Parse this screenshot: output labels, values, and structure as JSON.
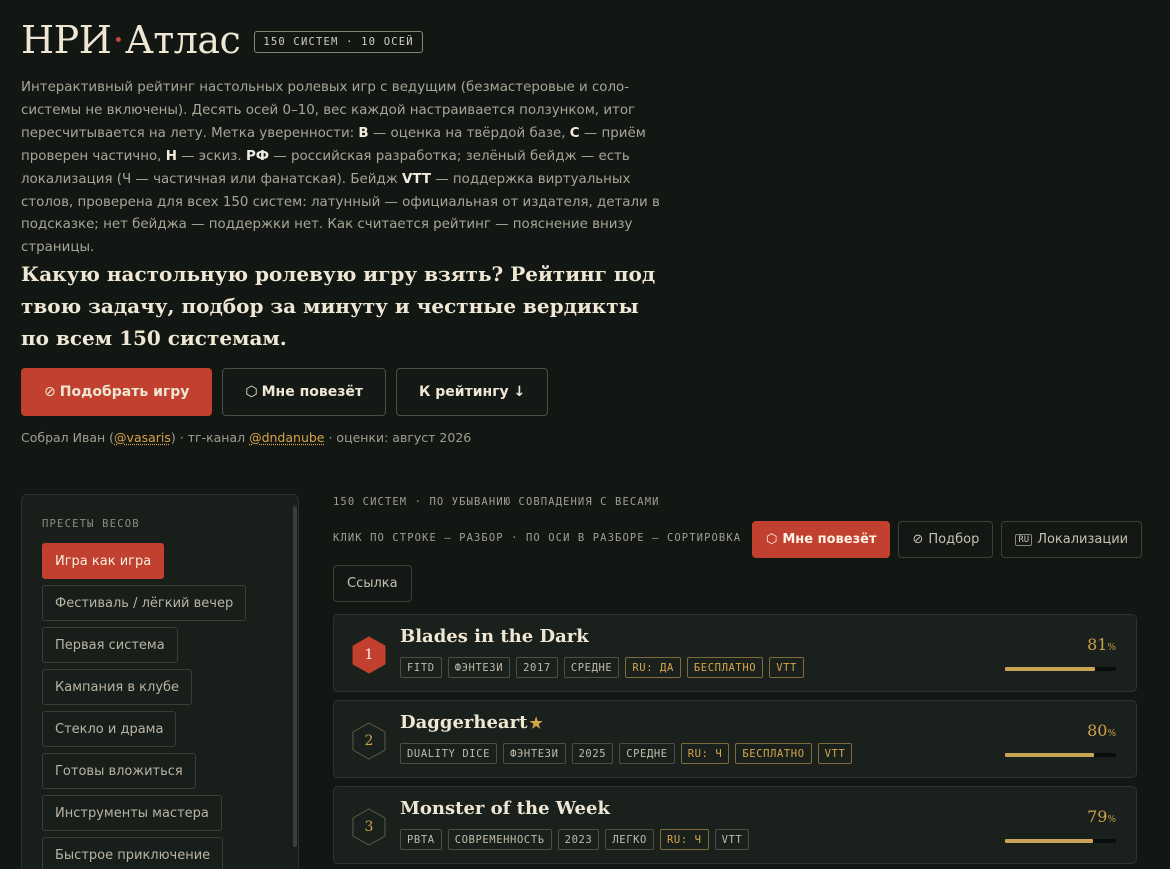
{
  "header": {
    "brand_part1": "НРИ",
    "brand_dot": "·",
    "brand_part2": "Атлас",
    "badge": "150 СИСТЕМ · 10 ОСЕЙ",
    "intro": [
      {
        "t": "Интерактивный рейтинг настольных ролевых игр с ведущим (безмастеровые и соло-системы не включены). Десять осей 0–10, вес каждой настраивается ползунком, итог пересчитывается на лету. Метка уверенности: "
      },
      {
        "t": "В",
        "b": true
      },
      {
        "t": " — оценка на твёрдой базе, "
      },
      {
        "t": "С",
        "b": true
      },
      {
        "t": " — приём проверен частично, "
      },
      {
        "t": "Н",
        "b": true
      },
      {
        "t": " — эскиз. "
      },
      {
        "t": "РФ",
        "b": true
      },
      {
        "t": " — российская разработка; зелёный бейдж — есть локализация (Ч — частичная или фанатская). Бейдж "
      },
      {
        "t": "VTT",
        "b": true
      },
      {
        "t": " — поддержка виртуальных столов, проверена для всех 150 систем: латунный — официальная от издателя, детали в подсказке; нет бейджа — поддержки нет. Как считается рейтинг — пояснение внизу страницы."
      }
    ],
    "headline": "Какую настольную ролевую игру взять? Рейтинг под твою задачу, подбор за минуту и честные вердикты по всем 150 системам."
  },
  "cta": {
    "pick_label": "Подобрать игру",
    "lucky_label": "Мне повезёт",
    "to_rating_label": "К рейтингу ↓"
  },
  "credits": {
    "prefix": "Собрал Иван (",
    "author_handle": "@vasaris",
    "mid": ") · тг-канал ",
    "channel_handle": "@dndanube",
    "suffix": " · оценки: август 2026"
  },
  "sidebar": {
    "title": "ПРЕСЕТЫ ВЕСОВ",
    "presets": [
      {
        "label": "Игра как игра",
        "active": true
      },
      {
        "label": "Фестиваль / лёгкий вечер",
        "active": false
      },
      {
        "label": "Первая система",
        "active": false
      },
      {
        "label": "Кампания в клубе",
        "active": false
      },
      {
        "label": "Стекло и драма",
        "active": false
      },
      {
        "label": "Готовы вложиться",
        "active": false
      },
      {
        "label": "Инструменты мастера",
        "active": false
      },
      {
        "label": "Быстрое приключение",
        "active": false
      }
    ]
  },
  "main": {
    "meta_line1": "150 СИСТЕМ · ПО УБЫВАНИЮ СОВПАДЕНИЯ С ВЕСАМИ",
    "meta_line2": "КЛИК ПО СТРОКЕ — РАЗБОР · ПО ОСИ В РАЗБОРЕ — СОРТИРОВКА",
    "toolbar": {
      "lucky_label": "Мне повезёт",
      "pick_label": "Подбор",
      "ru_badge": "RU",
      "loc_label": "Локализации",
      "link_label": "Ссылка"
    },
    "rows": [
      {
        "rank": "1",
        "name": "Blades in the Dark",
        "starred": false,
        "tags": [
          {
            "label": "FITD",
            "gold": false
          },
          {
            "label": "ФЭНТЕЗИ",
            "gold": false
          },
          {
            "label": "2017",
            "gold": false
          },
          {
            "label": "СРЕДНЕ",
            "gold": false
          },
          {
            "label": "RU: ДА",
            "gold": true
          },
          {
            "label": "БЕСПЛАТНО",
            "gold": true
          },
          {
            "label": "VTT",
            "gold": true
          }
        ],
        "score": 81,
        "score_unit": "%"
      },
      {
        "rank": "2",
        "name": "Daggerheart",
        "starred": true,
        "tags": [
          {
            "label": "DUALITY DICE",
            "gold": false
          },
          {
            "label": "ФЭНТЕЗИ",
            "gold": false
          },
          {
            "label": "2025",
            "gold": false
          },
          {
            "label": "СРЕДНЕ",
            "gold": false
          },
          {
            "label": "RU: Ч",
            "gold": true
          },
          {
            "label": "БЕСПЛАТНО",
            "gold": true
          },
          {
            "label": "VTT",
            "gold": true
          }
        ],
        "score": 80,
        "score_unit": "%"
      },
      {
        "rank": "3",
        "name": "Monster of the Week",
        "starred": false,
        "tags": [
          {
            "label": "PBTA",
            "gold": false
          },
          {
            "label": "СОВРЕМЕННОСТЬ",
            "gold": false
          },
          {
            "label": "2023",
            "gold": false
          },
          {
            "label": "ЛЕГКО",
            "gold": false
          },
          {
            "label": "RU: Ч",
            "gold": true
          },
          {
            "label": "VTT",
            "gold": false
          }
        ],
        "score": 79,
        "score_unit": "%"
      }
    ]
  },
  "colors": {
    "accent": "#c1402f",
    "gold": "#d4a64a",
    "background": "#121714"
  }
}
